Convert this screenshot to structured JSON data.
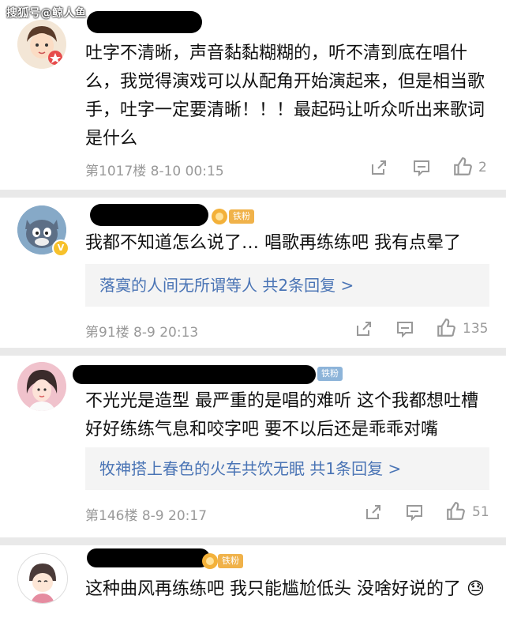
{
  "watermark": "搜狐号@鲸人鱼",
  "comments": [
    {
      "badge": "",
      "text": "吐字不清晰，声音黏黏糊糊的，听不清到底在唱什么，我觉得演戏可以从配角开始演起来，但是相当歌手，吐字一定要清晰！！！最起码让听众听出来歌词是什么",
      "reply": "",
      "meta": "第1017楼  8-10 00:15",
      "likes": "2"
    },
    {
      "badge": "铁粉",
      "text": "我都不知道怎么说了… 唱歌再练练吧 我有点晕了",
      "reply": "落寞的人间无所谓等人  共2条回复 >",
      "meta": "第91楼  8-9 20:13",
      "likes": "135"
    },
    {
      "badge": "铁粉",
      "text": "不光光是造型 最严重的是唱的难听 这个我都想吐槽 好好练练气息和咬字吧 要不以后还是乖乖对嘴",
      "reply": "牧神搭上春色的火车共饮无眠  共1条回复 >",
      "meta": "第146楼  8-9 20:17",
      "likes": "51"
    },
    {
      "badge": "铁粉",
      "text": "这种曲风再练练吧 我只能尴尬低头 没啥好说的了 😓",
      "reply": "",
      "meta": "",
      "likes": ""
    }
  ]
}
